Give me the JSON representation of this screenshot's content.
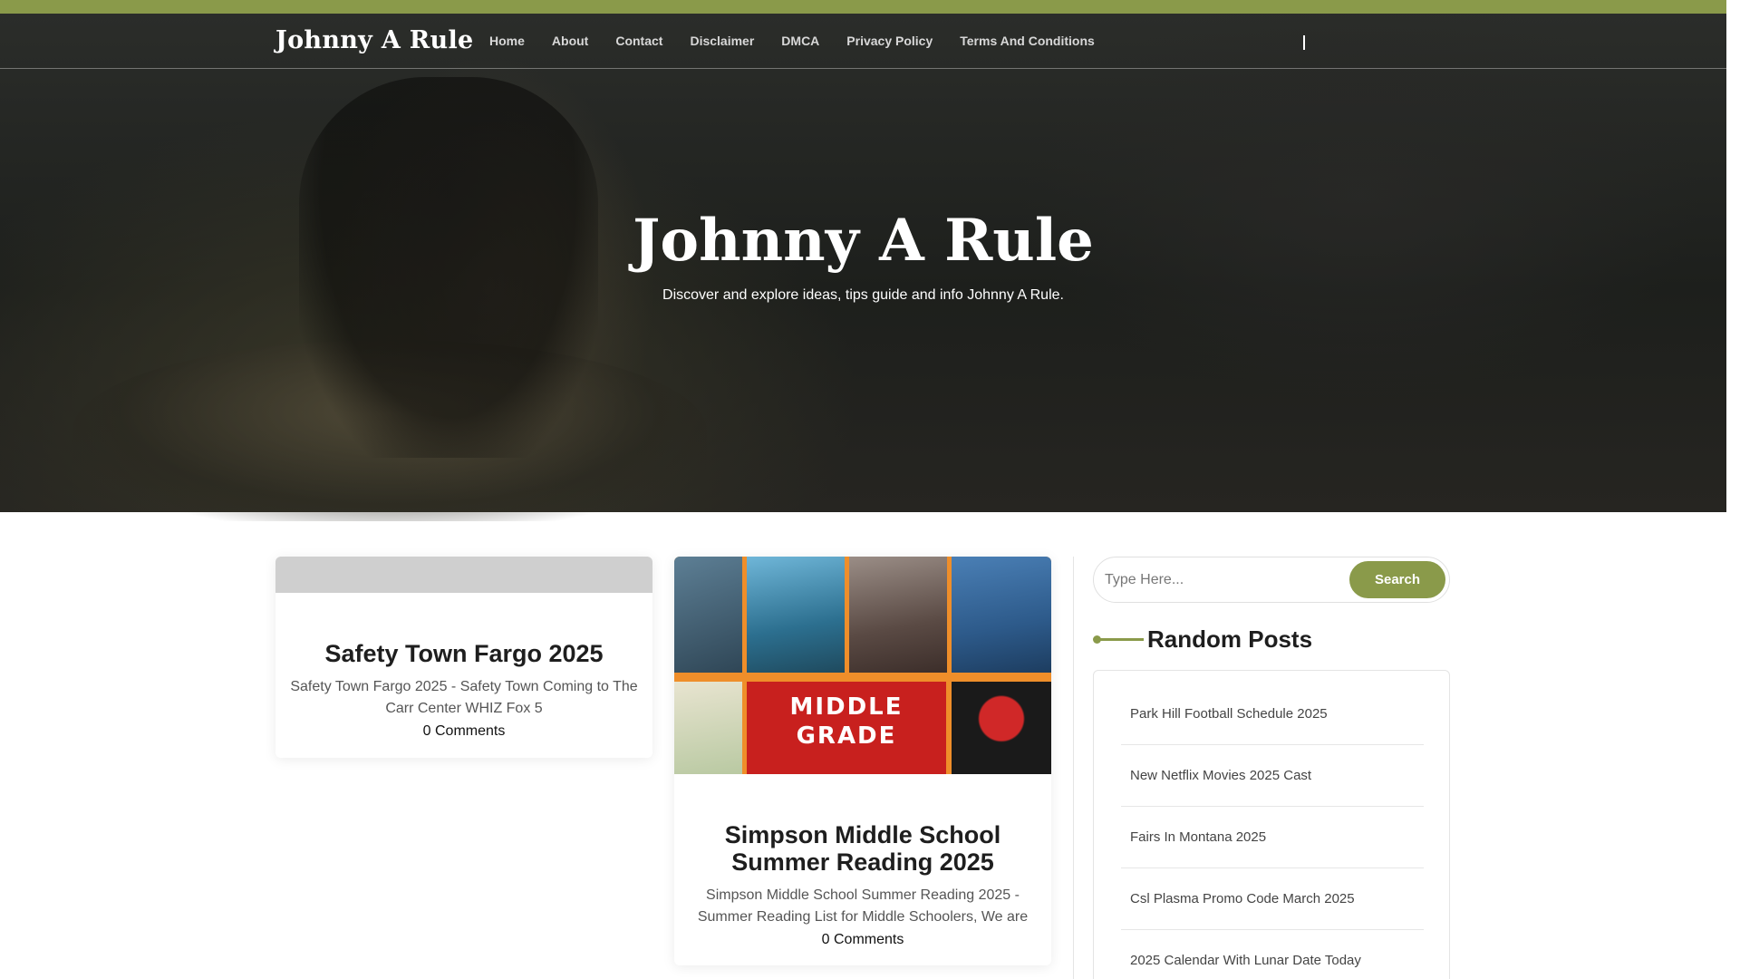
{
  "site": {
    "logo": "Johnny A Rule"
  },
  "nav": {
    "items": [
      {
        "label": "Home"
      },
      {
        "label": "About"
      },
      {
        "label": "Contact"
      },
      {
        "label": "Disclaimer"
      },
      {
        "label": "DMCA"
      },
      {
        "label": "Privacy Policy"
      },
      {
        "label": "Terms And Conditions"
      }
    ]
  },
  "hero": {
    "title": "Johnny A Rule",
    "tagline": "Discover and explore ideas, tips guide and info Johnny A Rule."
  },
  "posts": [
    {
      "title": "Safety Town Fargo 2025",
      "excerpt": "Safety Town Fargo 2025 - Safety Town Coming to The Carr Center WHIZ Fox 5",
      "comments": "0 Comments"
    },
    {
      "title": "Simpson Middle School Summer Reading 2025",
      "excerpt": "Simpson Middle School Summer Reading 2025 - Summer Reading List for Middle Schoolers, We are",
      "comments": "0 Comments",
      "image_text": "MIDDLE GRADE"
    }
  ],
  "sidebar": {
    "search": {
      "placeholder": "Type Here...",
      "button_label": "Search"
    },
    "random_posts": {
      "title": "Random Posts",
      "items": [
        {
          "label": "Park Hill Football Schedule 2025"
        },
        {
          "label": "New Netflix Movies 2025 Cast"
        },
        {
          "label": "Fairs In Montana 2025"
        },
        {
          "label": "Csl Plasma Promo Code March 2025"
        },
        {
          "label": "2025 Calendar With Lunar Date Today"
        }
      ]
    }
  },
  "colors": {
    "accent": "#8a9a4a",
    "hero_dark": "#1d1f1c"
  },
  "icons": {
    "search_toggle": "search-toggle-icon"
  }
}
